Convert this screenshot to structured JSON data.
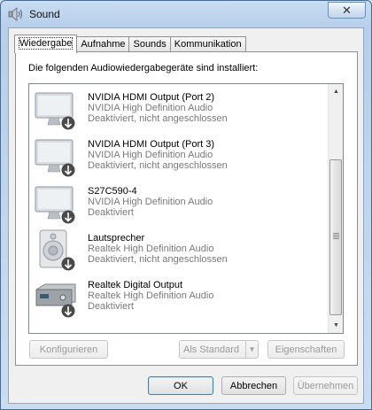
{
  "window": {
    "title": "Sound",
    "close_label": "✕"
  },
  "tabs": [
    {
      "label": "Wiedergabe",
      "active": true
    },
    {
      "label": "Aufnahme",
      "active": false
    },
    {
      "label": "Sounds",
      "active": false
    },
    {
      "label": "Kommunikation",
      "active": false
    }
  ],
  "intro": "Die folgenden Audiowiedergabegeräte sind installiert:",
  "devices": [
    {
      "name": "NVIDIA HDMI Output (Port 2)",
      "driver": "NVIDIA High Definition Audio",
      "status": "Deaktiviert, nicht angeschlossen",
      "icon": "monitor-icon"
    },
    {
      "name": "NVIDIA HDMI Output (Port 3)",
      "driver": "NVIDIA High Definition Audio",
      "status": "Deaktiviert, nicht angeschlossen",
      "icon": "monitor-icon"
    },
    {
      "name": "S27C590-4",
      "driver": "NVIDIA High Definition Audio",
      "status": "Deaktiviert",
      "icon": "monitor-icon"
    },
    {
      "name": "Lautsprecher",
      "driver": "Realtek High Definition Audio",
      "status": "Deaktiviert, nicht angeschlossen",
      "icon": "speaker-icon"
    },
    {
      "name": "Realtek Digital Output",
      "driver": "Realtek High Definition Audio",
      "status": "Deaktiviert",
      "icon": "receiver-icon"
    }
  ],
  "buttons": {
    "configure": "Konfigurieren",
    "set_default": "Als Standard",
    "properties": "Eigenschaften",
    "ok": "OK",
    "cancel": "Abbrechen",
    "apply": "Übernehmen"
  }
}
